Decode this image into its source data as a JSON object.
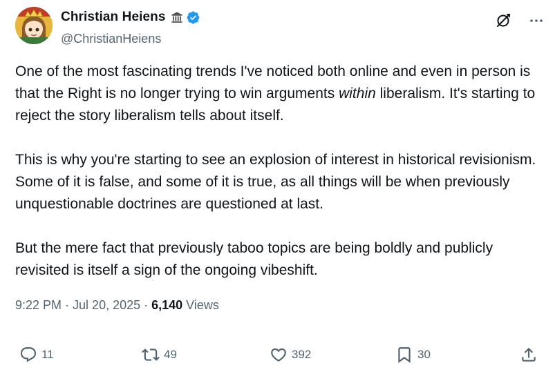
{
  "author": {
    "display_name": "Christian Heiens",
    "handle": "@ChristianHeiens",
    "badges": [
      "classical-building-icon",
      "verified-badge-icon"
    ]
  },
  "header_actions": [
    "grok-icon",
    "more-options-icon"
  ],
  "tweet": {
    "para1_a": "One of the most fascinating trends I've noticed both online and even in person is that the Right is no longer trying to win arguments ",
    "para1_em": "within",
    "para1_b": " liberalism. It's starting to reject the story liberalism tells about itself.",
    "para2": "This is why you're starting to see an explosion of interest in historical revisionism. Some of it is false, and some of it is true, as all things will be when previously unquestionable doctrines are questioned at last.",
    "para3": "But the mere fact that previously taboo topics are being boldly and publicly revisited is itself a sign of the ongoing vibeshift."
  },
  "meta": {
    "time": "9:22 PM",
    "sep1": " · ",
    "date": "Jul 20, 2025",
    "sep2": " · ",
    "views_count": "6,140",
    "views_label": " Views"
  },
  "actions": {
    "replies": "11",
    "reposts": "49",
    "likes": "392",
    "bookmarks": "30"
  },
  "colors": {
    "text": "#0f1419",
    "secondary": "#536471",
    "verified": "#1d9bf0"
  }
}
